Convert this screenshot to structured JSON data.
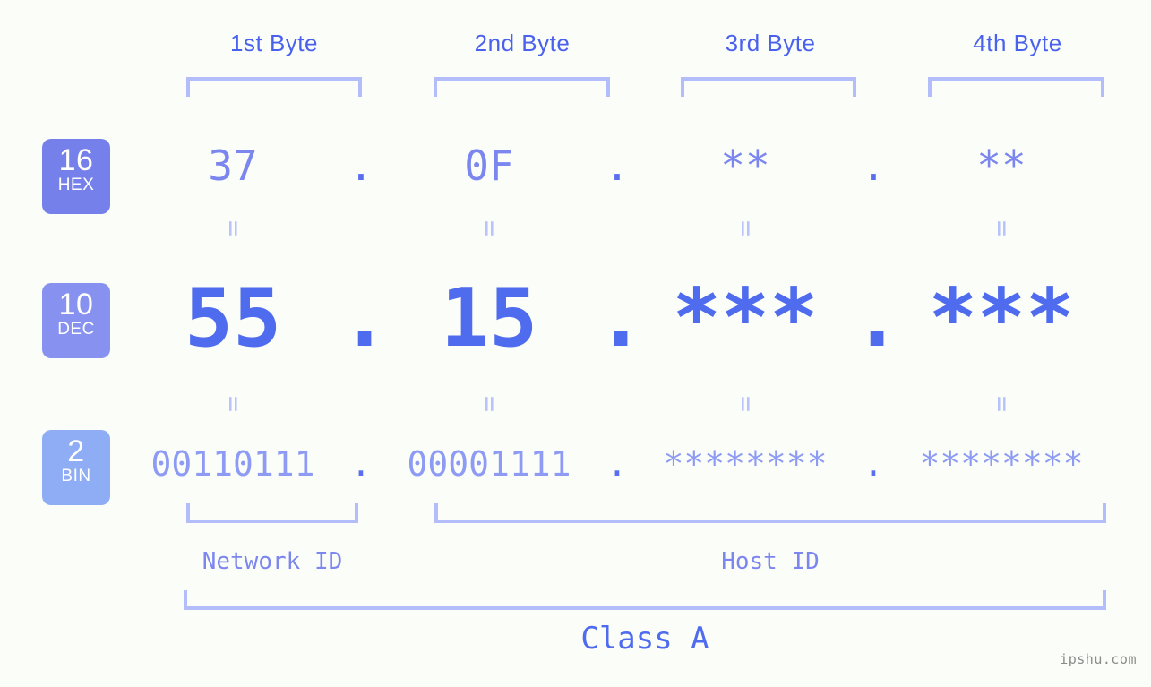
{
  "background_color": "#fbfdf8",
  "accent_colors": {
    "primary": "#4f6bee",
    "light": "#b3bdfb",
    "mid": "#7b86ee",
    "badge_hex": "#7680ea",
    "badge_dec": "#8791f0",
    "badge_bin": "#8fadf5",
    "watermark": "#8a8a8a"
  },
  "byte_headers": [
    {
      "label": "1st Byte"
    },
    {
      "label": "2nd Byte"
    },
    {
      "label": "3rd Byte"
    },
    {
      "label": "4th Byte"
    }
  ],
  "bases": [
    {
      "number": "16",
      "name": "HEX"
    },
    {
      "number": "10",
      "name": "DEC"
    },
    {
      "number": "2",
      "name": "BIN"
    }
  ],
  "rows": {
    "hex": {
      "base_number": "16",
      "base_name": "HEX",
      "values": [
        "37",
        "0F",
        "**",
        "**"
      ],
      "separators": [
        ".",
        ".",
        "."
      ]
    },
    "dec": {
      "base_number": "10",
      "base_name": "DEC",
      "values": [
        "55",
        "15",
        "***",
        "***"
      ],
      "separators": [
        ".",
        ".",
        "."
      ]
    },
    "bin": {
      "base_number": "2",
      "base_name": "BIN",
      "values": [
        "00110111",
        "00001111",
        "********",
        "********"
      ],
      "separators": [
        ".",
        ".",
        "."
      ]
    }
  },
  "equals_marks": {
    "glyph": "=",
    "row1": [
      "=",
      "=",
      "=",
      "="
    ],
    "row2": [
      "=",
      "=",
      "=",
      "="
    ]
  },
  "id_sections": [
    {
      "label": "Network ID"
    },
    {
      "label": "Host ID"
    }
  ],
  "class": {
    "label": "Class A"
  },
  "watermark": {
    "text": "ipshu.com"
  }
}
